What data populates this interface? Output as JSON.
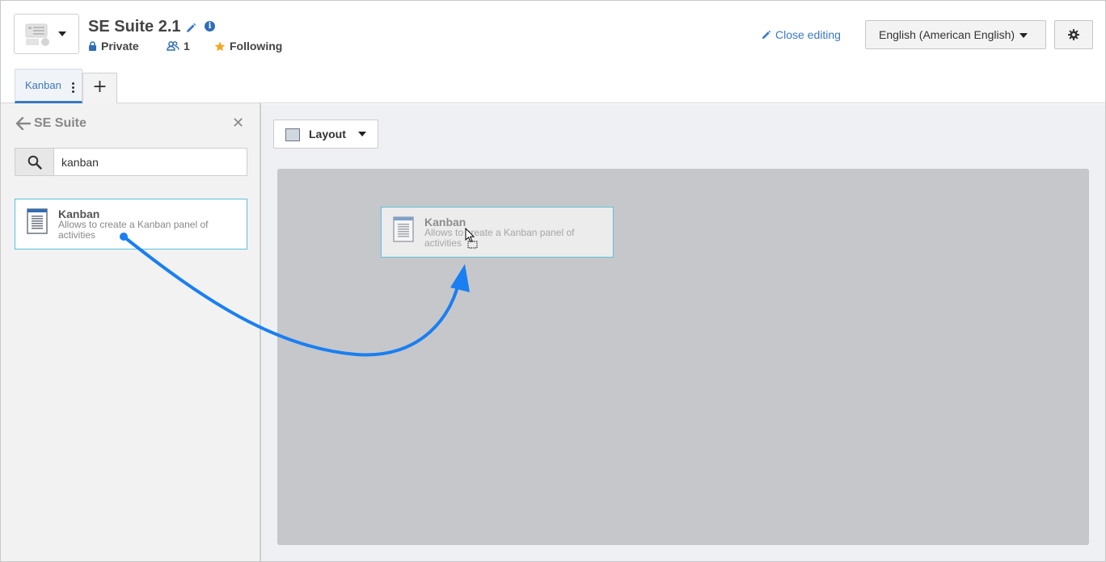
{
  "header": {
    "title": "SE Suite 2.1",
    "privacy": "Private",
    "members_count": "1",
    "following": "Following",
    "close_editing": "Close editing",
    "language": "English (American English)"
  },
  "tabs": [
    {
      "label": "Kanban",
      "active": true
    }
  ],
  "add_tab_label": "+",
  "left_panel": {
    "back_label": "SE Suite",
    "search": {
      "value": "kanban",
      "placeholder": ""
    },
    "results": [
      {
        "title": "Kanban",
        "description": "Allows to create a Kanban panel of activities"
      }
    ]
  },
  "main": {
    "layout_label": "Layout",
    "dragged_widget": {
      "title": "Kanban",
      "description": "Allows to create a Kanban panel of activities"
    }
  },
  "colors": {
    "accent": "#3a79c0",
    "drag_arrow": "#1a7ff0",
    "card_border": "#5bc0d8",
    "canvas": "#c6c7cb",
    "star": "#f5a623"
  },
  "icons": [
    "caret-down-icon",
    "pencil-icon",
    "info-icon",
    "lock-icon",
    "users-icon",
    "star-icon",
    "gear-icon",
    "arrow-left-icon",
    "close-icon",
    "search-icon",
    "document-icon",
    "cursor-icon"
  ]
}
